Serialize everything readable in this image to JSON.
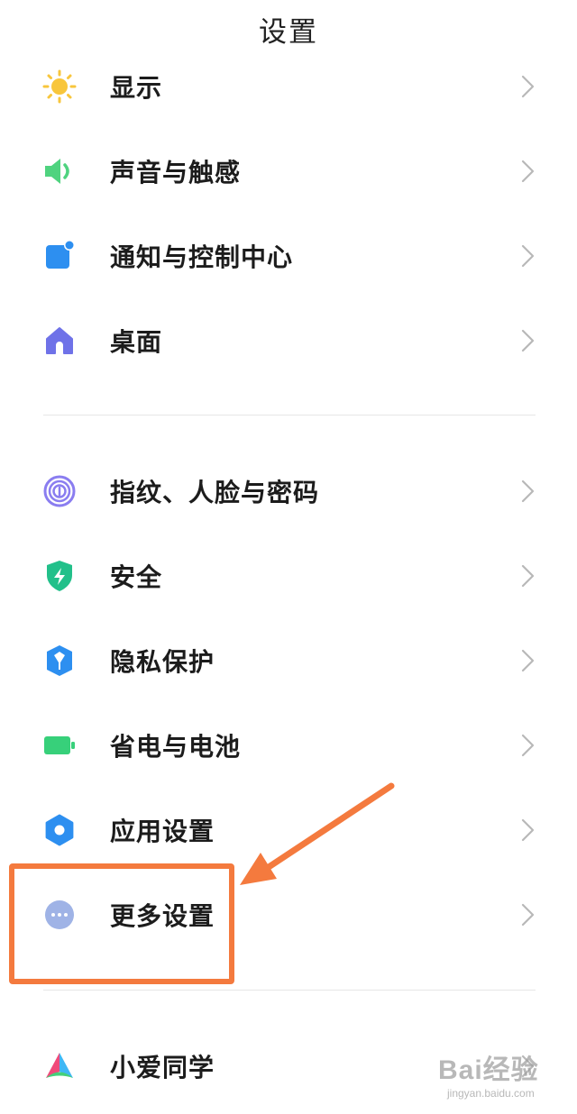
{
  "header": {
    "title": "设置"
  },
  "items": [
    {
      "label": "显示",
      "icon": "sun-icon"
    },
    {
      "label": "声音与触感",
      "icon": "speaker-icon"
    },
    {
      "label": "通知与控制中心",
      "icon": "notification-icon"
    },
    {
      "label": "桌面",
      "icon": "home-icon"
    },
    {
      "label": "指纹、人脸与密码",
      "icon": "fingerprint-icon"
    },
    {
      "label": "安全",
      "icon": "shield-icon"
    },
    {
      "label": "隐私保护",
      "icon": "privacy-icon"
    },
    {
      "label": "省电与电池",
      "icon": "battery-icon"
    },
    {
      "label": "应用设置",
      "icon": "gear-icon"
    },
    {
      "label": "更多设置",
      "icon": "more-icon"
    },
    {
      "label": "小爱同学",
      "icon": "assistant-icon"
    }
  ],
  "annotation": {
    "highlight_color": "#f47a3e"
  },
  "watermark": {
    "main": "Bai经验",
    "sub": "jingyan.baidu.com"
  }
}
